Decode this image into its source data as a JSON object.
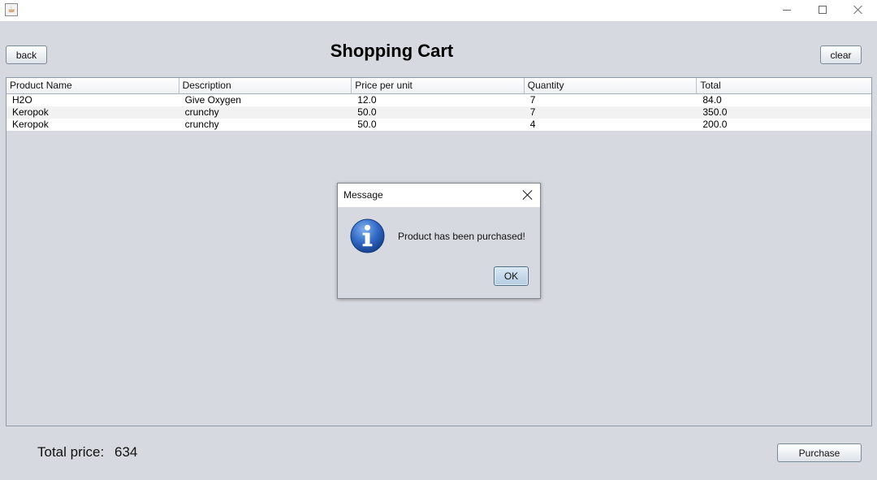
{
  "window": {
    "app_icon": "java-cup-icon",
    "app_icon_glyph": "☕",
    "min_icon": "minimize-icon",
    "max_icon": "maximize-icon",
    "close_icon": "close-icon"
  },
  "header": {
    "title": "Shopping Cart",
    "back_label": "back",
    "clear_label": "clear"
  },
  "table": {
    "columns": [
      "Product Name",
      "Description",
      "Price per unit",
      "Quantity",
      "Total"
    ],
    "rows": [
      [
        "H2O",
        "Give Oxygen",
        "12.0",
        "7",
        "84.0"
      ],
      [
        "Keropok",
        "crunchy",
        "50.0",
        "7",
        "350.0"
      ],
      [
        "Keropok",
        "crunchy",
        "50.0",
        "4",
        "200.0"
      ]
    ]
  },
  "dialog": {
    "title": "Message",
    "icon": "info-icon",
    "message": "Product has been purchased!",
    "ok_label": "OK"
  },
  "footer": {
    "total_label": "Total price:",
    "total_value": "634",
    "purchase_label": "Purchase"
  }
}
